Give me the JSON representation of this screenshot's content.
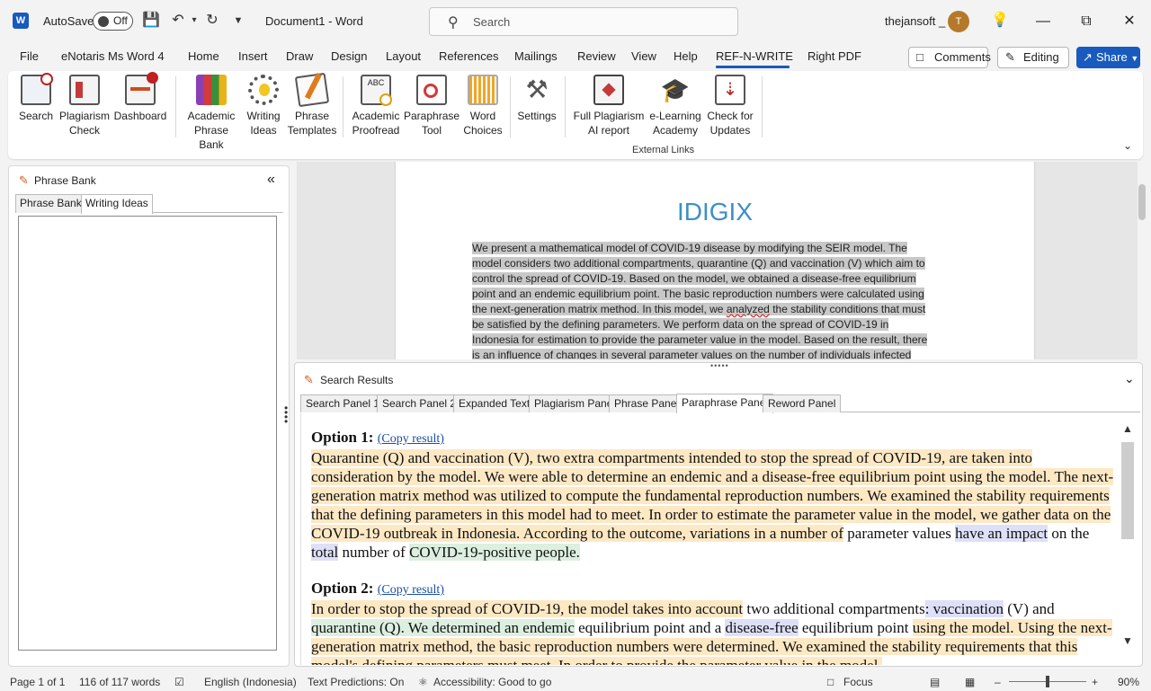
{
  "titlebar": {
    "autosave_label": "AutoSave",
    "autosave_state": "Off",
    "document_title": "Document1  -  Word",
    "search_placeholder": "Search",
    "user_name": "thejansoft _",
    "avatar_initial": "T"
  },
  "menu": {
    "items": [
      "File",
      "eNotaris Ms Word 4",
      "Home",
      "Insert",
      "Draw",
      "Design",
      "Layout",
      "References",
      "Mailings",
      "Review",
      "View",
      "Help",
      "REF-N-WRITE",
      "Right PDF"
    ],
    "comments_label": "Comments",
    "editing_label": "Editing",
    "share_label": "Share"
  },
  "ribbon": {
    "buttons": [
      {
        "line1": "Search",
        "line2": ""
      },
      {
        "line1": "Plagiarism",
        "line2": "Check"
      },
      {
        "line1": "Dashboard",
        "line2": ""
      },
      {
        "line1": "Academic",
        "line2": "Phrase Bank"
      },
      {
        "line1": "Writing",
        "line2": "Ideas"
      },
      {
        "line1": "Phrase",
        "line2": "Templates"
      },
      {
        "line1": "Academic",
        "line2": "Proofread"
      },
      {
        "line1": "Paraphrase",
        "line2": "Tool"
      },
      {
        "line1": "Word",
        "line2": "Choices"
      },
      {
        "line1": "Settings",
        "line2": ""
      },
      {
        "line1": "Full Plagiarism",
        "line2": "AI report"
      },
      {
        "line1": "e-Learning",
        "line2": "Academy"
      },
      {
        "line1": "Check for",
        "line2": "Updates"
      }
    ],
    "group_label": "External Links"
  },
  "left_panel": {
    "title": "Phrase Bank",
    "tabs": [
      "Phrase Bank",
      "Writing Ideas"
    ],
    "selected_tab": "Writing Ideas"
  },
  "document": {
    "title": "IDIGIX",
    "lines": [
      "We present a mathematical model of COVID-19 disease by modifying the SEIR model. The",
      "model considers two additional compartments, quarantine (Q) and vaccination (V) which aim to",
      "control the spread of COVID-19. Based on the model, we obtained a disease-free equilibrium",
      "point and an endemic equilibrium point. The basic reproduction numbers were calculated using",
      "the next-generation matrix method. In this model, we ",
      "be satisfied by the defining parameters. We perform data on the spread of COVID-19 in",
      "Indonesia for estimation to provide the parameter value in the model. Based on the result, there",
      "is an influence of changes in several parameter values on the number of individuals infected"
    ],
    "misspelled_word": "analyzed",
    "line5_tail": " the stability conditions that must"
  },
  "results_panel": {
    "title": "Search Results",
    "tabs": [
      "Search Panel 1",
      "Search Panel 2",
      "Expanded Text",
      "Plagiarism Panel",
      "Phrase Panel",
      "Paraphrase Panel",
      "Reword Panel"
    ],
    "selected_tab": "Paraphrase Panel",
    "copy_label": "(Copy result)",
    "option1": {
      "heading": "Option 1",
      "segments": [
        {
          "t": "Quarantine (Q) and vaccination (V), two extra compartments intended to stop the spread of COVID-19, are taken into consideration by the model. We were able to determine an endemic and a disease-free equilibrium point using the model. The next-generation matrix method was utilized to compute the fundamental reproduction numbers. We examined the stability requirements that the defining parameters in this model had to meet. In order to estimate the parameter value in the model, we gather data on the COVID-19 outbreak in Indonesia. According to the outcome, variations in a number of",
          "c": "y"
        },
        {
          "t": " parameter values ",
          "c": ""
        },
        {
          "t": "have an impact",
          "c": "b"
        },
        {
          "t": " on the ",
          "c": ""
        },
        {
          "t": "total",
          "c": "b"
        },
        {
          "t": " number of ",
          "c": ""
        },
        {
          "t": "COVID-19-positive people.",
          "c": "g"
        }
      ]
    },
    "option2": {
      "heading": "Option 2",
      "segments": [
        {
          "t": "In order to stop the spread of COVID-19, the model takes into account",
          "c": "y"
        },
        {
          "t": " two additional compartments",
          "c": ""
        },
        {
          "t": ": vaccination",
          "c": "b"
        },
        {
          "t": " (V) and ",
          "c": ""
        },
        {
          "t": "quarantine (Q). We determined an endemic",
          "c": "g"
        },
        {
          "t": " equilibrium point and a ",
          "c": ""
        },
        {
          "t": "disease-free",
          "c": "b"
        },
        {
          "t": " equilibrium point ",
          "c": ""
        },
        {
          "t": "using the model. Using the next-generation matrix method, the basic reproduction numbers were determined. We examined the stability requirements that this model's defining parameters must meet. In order to provide the parameter value in the model,",
          "c": "y"
        }
      ]
    }
  },
  "statusbar": {
    "page": "Page 1 of 1",
    "words": "116 of 117 words",
    "language": "English (Indonesia)",
    "predictions": "Text Predictions: On",
    "accessibility": "Accessibility: Good to go",
    "focus": "Focus",
    "zoom": "90%"
  },
  "colors": {
    "accent": "#185abd",
    "highlight_yellow": "#fde8c4",
    "highlight_green": "#dcefe0",
    "highlight_blue": "#dde0f7",
    "doc_title": "#3d8fc7"
  }
}
